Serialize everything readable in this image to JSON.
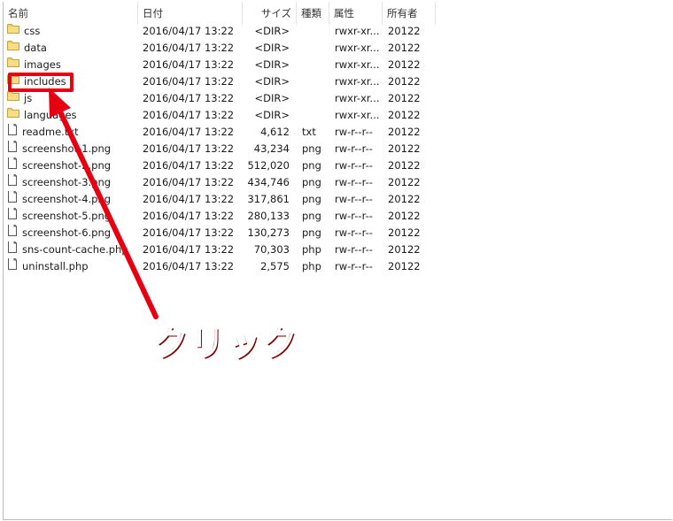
{
  "columns": {
    "name": "名前",
    "date": "日付",
    "size": "サイズ",
    "type": "種類",
    "attr": "属性",
    "owner": "所有者"
  },
  "files": [
    {
      "name": "css",
      "date": "2016/04/17 13:22",
      "size": "<DIR>",
      "type": "",
      "attr": "rwxr-xr...",
      "owner": "20122",
      "icon": "folder-icon"
    },
    {
      "name": "data",
      "date": "2016/04/17 13:22",
      "size": "<DIR>",
      "type": "",
      "attr": "rwxr-xr...",
      "owner": "20122",
      "icon": "folder-icon"
    },
    {
      "name": "images",
      "date": "2016/04/17 13:22",
      "size": "<DIR>",
      "type": "",
      "attr": "rwxr-xr...",
      "owner": "20122",
      "icon": "folder-icon"
    },
    {
      "name": "includes",
      "date": "2016/04/17 13:22",
      "size": "<DIR>",
      "type": "",
      "attr": "rwxr-xr...",
      "owner": "20122",
      "icon": "folder-icon"
    },
    {
      "name": "js",
      "date": "2016/04/17 13:22",
      "size": "<DIR>",
      "type": "",
      "attr": "rwxr-xr...",
      "owner": "20122",
      "icon": "folder-icon"
    },
    {
      "name": "languages",
      "date": "2016/04/17 13:22",
      "size": "<DIR>",
      "type": "",
      "attr": "rwxr-xr...",
      "owner": "20122",
      "icon": "folder-icon"
    },
    {
      "name": "readme.txt",
      "date": "2016/04/17 13:22",
      "size": "4,612",
      "type": "txt",
      "attr": "rw-r--r--",
      "owner": "20122",
      "icon": "file-icon"
    },
    {
      "name": "screenshot-1.png",
      "date": "2016/04/17 13:22",
      "size": "43,234",
      "type": "png",
      "attr": "rw-r--r--",
      "owner": "20122",
      "icon": "file-icon"
    },
    {
      "name": "screenshot-2.png",
      "date": "2016/04/17 13:22",
      "size": "512,020",
      "type": "png",
      "attr": "rw-r--r--",
      "owner": "20122",
      "icon": "file-icon"
    },
    {
      "name": "screenshot-3.png",
      "date": "2016/04/17 13:22",
      "size": "434,746",
      "type": "png",
      "attr": "rw-r--r--",
      "owner": "20122",
      "icon": "file-icon"
    },
    {
      "name": "screenshot-4.png",
      "date": "2016/04/17 13:22",
      "size": "317,861",
      "type": "png",
      "attr": "rw-r--r--",
      "owner": "20122",
      "icon": "file-icon"
    },
    {
      "name": "screenshot-5.png",
      "date": "2016/04/17 13:22",
      "size": "280,133",
      "type": "png",
      "attr": "rw-r--r--",
      "owner": "20122",
      "icon": "file-icon"
    },
    {
      "name": "screenshot-6.png",
      "date": "2016/04/17 13:22",
      "size": "130,273",
      "type": "png",
      "attr": "rw-r--r--",
      "owner": "20122",
      "icon": "file-icon"
    },
    {
      "name": "sns-count-cache.php",
      "date": "2016/04/17 13:22",
      "size": "70,303",
      "type": "php",
      "attr": "rw-r--r--",
      "owner": "20122",
      "icon": "file-icon"
    },
    {
      "name": "uninstall.php",
      "date": "2016/04/17 13:22",
      "size": "2,575",
      "type": "php",
      "attr": "rw-r--r--",
      "owner": "20122",
      "icon": "file-icon"
    }
  ],
  "annotation": {
    "label": "クリック",
    "color": "#e60012",
    "highlighted_item": "includes"
  }
}
